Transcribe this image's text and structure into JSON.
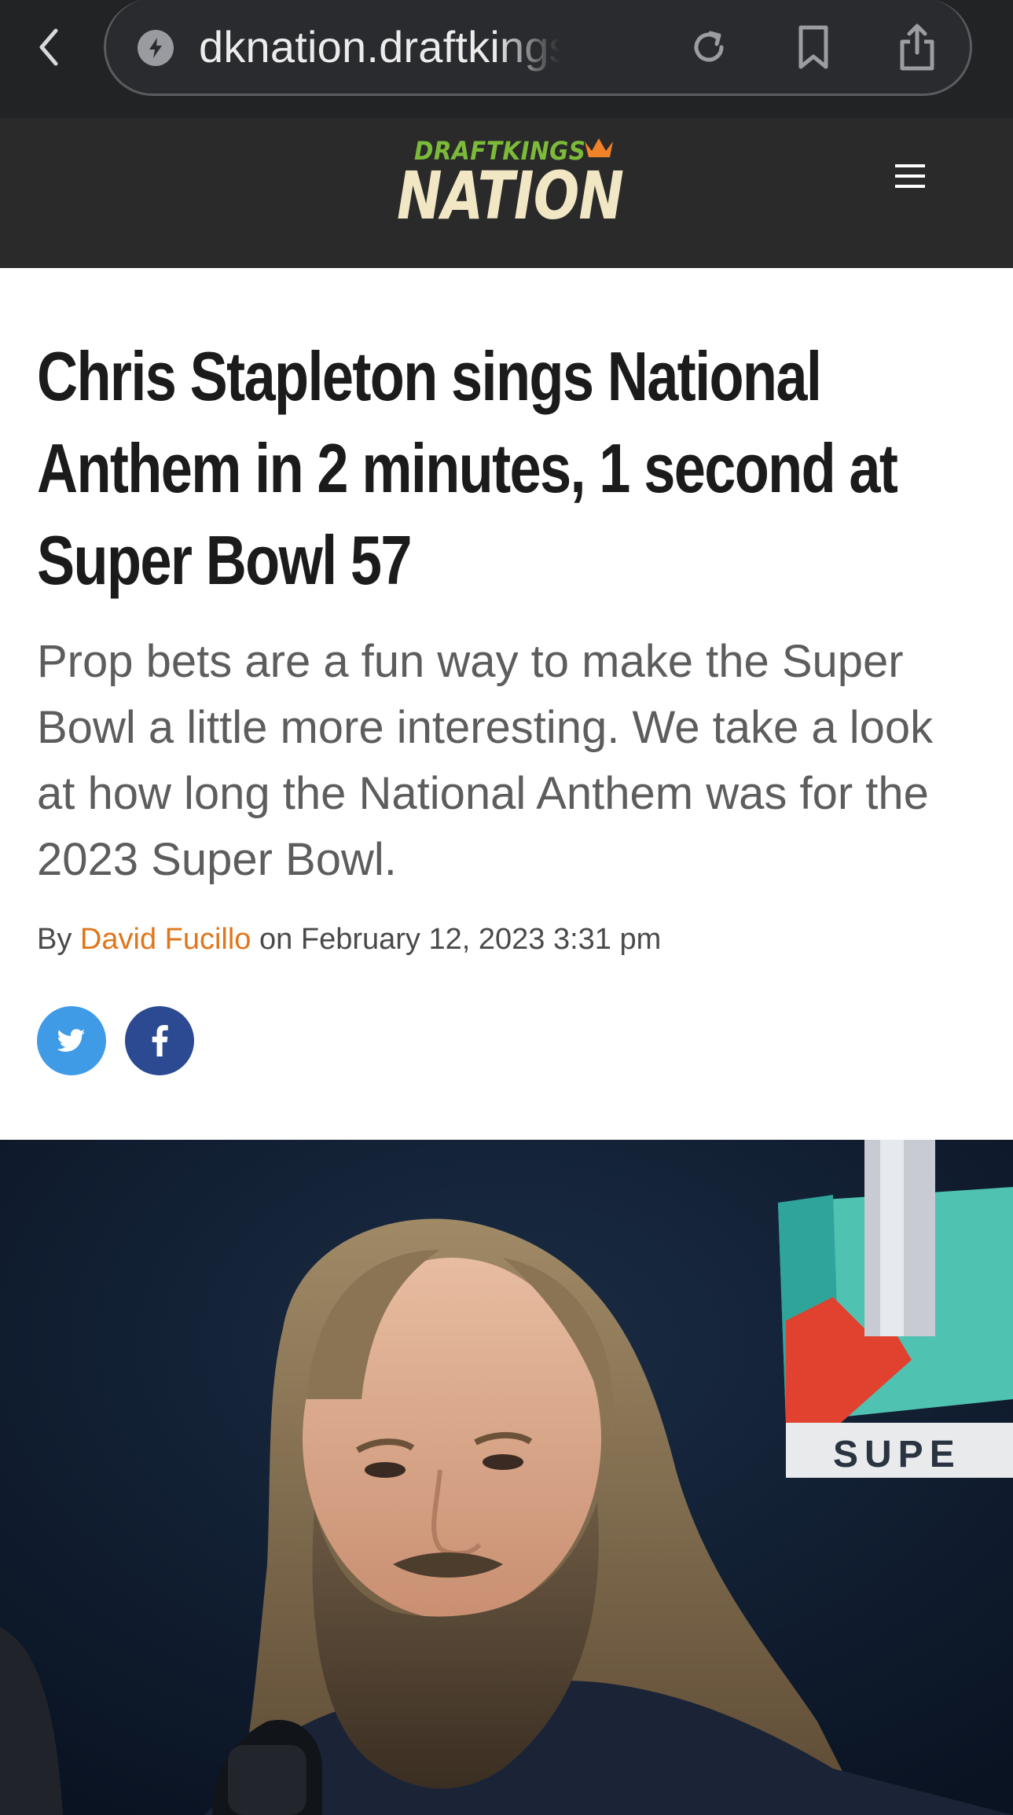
{
  "browser": {
    "url": "dknation.draftkings.com",
    "icons": [
      "back-icon",
      "lightning-icon",
      "reload-icon",
      "bookmark-icon",
      "share-icon"
    ]
  },
  "site": {
    "logo_top": "DRAFTKINGS",
    "logo_bottom": "NATION",
    "menu_icon": "hamburger-menu-icon",
    "colors": {
      "header_bg": "#2a2a2a",
      "logo_green": "#7cba3a",
      "logo_cream": "#f1e7c4",
      "crown_orange": "#f0822a"
    }
  },
  "article": {
    "headline": "Chris Stapleton sings National Anthem in 2 minutes, 1 second at Super Bowl 57",
    "dek": "Prop bets are a fun way to make the Super Bowl a little more interesting. We take a look at how long the National Anthem was for the 2023 Super Bowl.",
    "byline_prefix": "By",
    "author": "David Fucillo",
    "byline_middle": "on",
    "date": "February 12, 2023 3:31 pm",
    "author_color": "#e0761c"
  },
  "share": {
    "twitter_icon": "twitter-icon",
    "facebook_icon": "facebook-icon",
    "twitter_color": "#3f9be6",
    "facebook_color": "#2c4a92"
  },
  "hero": {
    "backdrop_text": "SUPE"
  }
}
